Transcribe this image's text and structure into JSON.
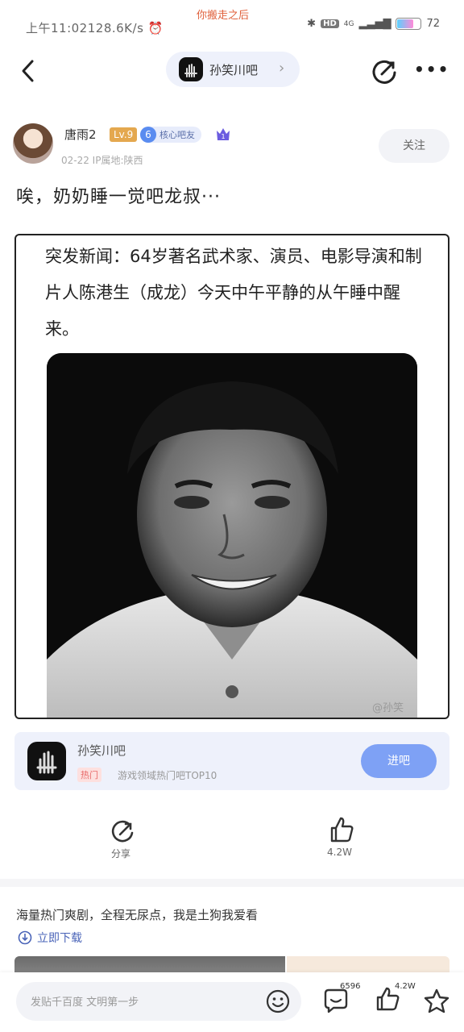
{
  "status_bar": {
    "time": "上午11:02",
    "speed": "128.6K/s",
    "notification": "你搬走之后",
    "network": "4G",
    "battery": "72"
  },
  "header": {
    "forum_name": "孙笑川吧"
  },
  "post": {
    "author": {
      "name": "唐雨2",
      "level": "Lv.9",
      "badge_number": "6",
      "badge_text": "核心吧友",
      "crown_number": "1",
      "meta": "02-22  IP属地:陕西"
    },
    "follow_label": "关注",
    "text": "唉，奶奶睡一觉吧龙叔···",
    "image": {
      "news_text": "突发新闻：64岁著名武术家、演员、电影导演和制片人陈港生（成龙）今天中午平静的从午睡中醒来。",
      "watermark": "@孙笑"
    }
  },
  "forum_card": {
    "name": "孙笑川吧",
    "hot_tag": "热门",
    "rank_text": "游戏领域热门吧TOP10",
    "enter_label": "进吧"
  },
  "actions": {
    "share_label": "分享",
    "like_count": "4.2W"
  },
  "ad": {
    "text": "海量热门爽剧，全程无尿点，我是土狗我爱看",
    "download_label": "立即下载"
  },
  "bottom_bar": {
    "reply_placeholder": "发贴千百度 文明第一步",
    "comment_count": "6596",
    "like_count": "4.2W"
  }
}
